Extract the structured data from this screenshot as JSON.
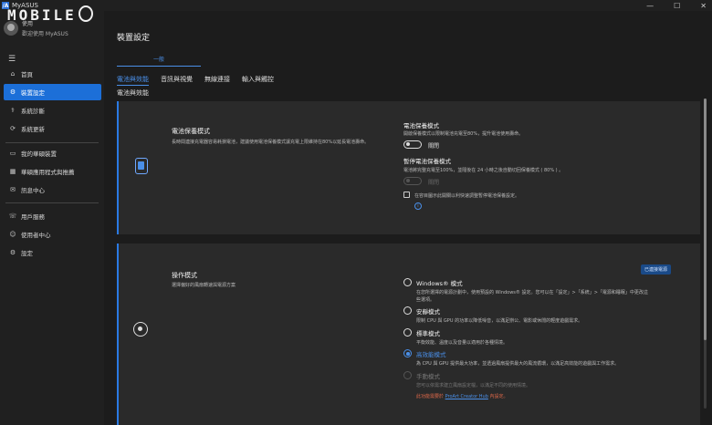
{
  "window": {
    "logo": "/A",
    "title": "MyASUS",
    "controls": [
      "—",
      "☐",
      "✕"
    ]
  },
  "watermark": {
    "text": "MOBILE"
  },
  "user": {
    "name": "使用",
    "welcome": "歡迎使用 MyASUS"
  },
  "sidebar": {
    "items": [
      {
        "label": "首頁",
        "icon": "home-icon",
        "glyph": "⌂"
      },
      {
        "label": "裝置設定",
        "icon": "sliders-icon",
        "glyph": "⚙"
      },
      {
        "label": "系統診斷",
        "icon": "diagnosis-icon",
        "glyph": "⚕"
      },
      {
        "label": "系統更新",
        "icon": "update-icon",
        "glyph": "⟳"
      },
      {
        "label": "我的華碩裝置",
        "icon": "device-icon",
        "glyph": "▭"
      },
      {
        "label": "華碩應用程式與推薦",
        "icon": "apps-icon",
        "glyph": "▦"
      },
      {
        "label": "訊息中心",
        "icon": "message-icon",
        "glyph": "✉"
      },
      {
        "label": "用戶服務",
        "icon": "support-icon",
        "glyph": "☏"
      },
      {
        "label": "使用者中心",
        "icon": "user-icon",
        "glyph": "☺"
      },
      {
        "label": "設定",
        "icon": "gear-icon",
        "glyph": "⚙"
      }
    ]
  },
  "main": {
    "page_title": "裝置設定",
    "subtab": "一般",
    "tabs": [
      "電池與效能",
      "音訊與視覺",
      "無線連接",
      "輸入與觸控"
    ],
    "section_label": "電池與效能"
  },
  "battery_card": {
    "title": "電池保養模式",
    "desc": "長時間連接充電器容易耗損電池，建議使用電池保養模式讓充電上限維持在80%以延長電池壽命。",
    "mode_title": "電池保養模式",
    "mode_desc": "開啟保養模式以限制電池充電至80%，提升電池使用壽命。",
    "mode_toggle_label": "關閉",
    "pause_title": "暫停電池保養模式",
    "pause_desc": "電池將完整充電至100%，並隨後在 24 小時之後自動切回保養模式 ( 80% ) 。",
    "pause_toggle_label": "關閉",
    "tray_checkbox_label": "在容目圖示此開關以利快速調整暫停電池保養設定。",
    "info_glyph": "i"
  },
  "mode_card": {
    "title": "操作模式",
    "desc": "選擇偏好的風扇轉速與電源方案",
    "badge": "已連接電源",
    "options": [
      {
        "title": "Windows® 模式",
        "desc_line1": "在您所選擇的電源計劃中，使用預設的 Windows® 設定。您可以在「設定」>「系統」>「電源和睡眠」中更改這",
        "desc_line2": "些選項。"
      },
      {
        "title": "安靜模式",
        "desc_line1": "限制 CPU 與 GPU 的功率以降低噪音，以滿足辦公、電影或休閒的輕度遊戲需求。",
        "desc_line2": ""
      },
      {
        "title": "標準模式",
        "desc_line1": "平衡效能、溫度以及音量以適用於各種情境。",
        "desc_line2": ""
      },
      {
        "title": "高效能模式",
        "desc_line1": "為 CPU 與 GPU 提供最大功率，並透過風扇提供最大的風流循環，以滿足高效能的遊戲與工作需求。",
        "desc_line2": ""
      },
      {
        "title": "手動模式",
        "desc_line1": "您可以依需求建立風扇設定檔，以滿足不同的使用情境。",
        "desc_line2": ""
      }
    ],
    "note_prefix": "此功能需要於 ",
    "note_link": "ProArt Creator Hub",
    "note_suffix": " 內設定。"
  },
  "colors": {
    "accent": "#1c6fd8",
    "link": "#4a8fe8",
    "warning": "#e36a4a",
    "background": "#1c1c1c",
    "card": "#2a2a2a"
  }
}
